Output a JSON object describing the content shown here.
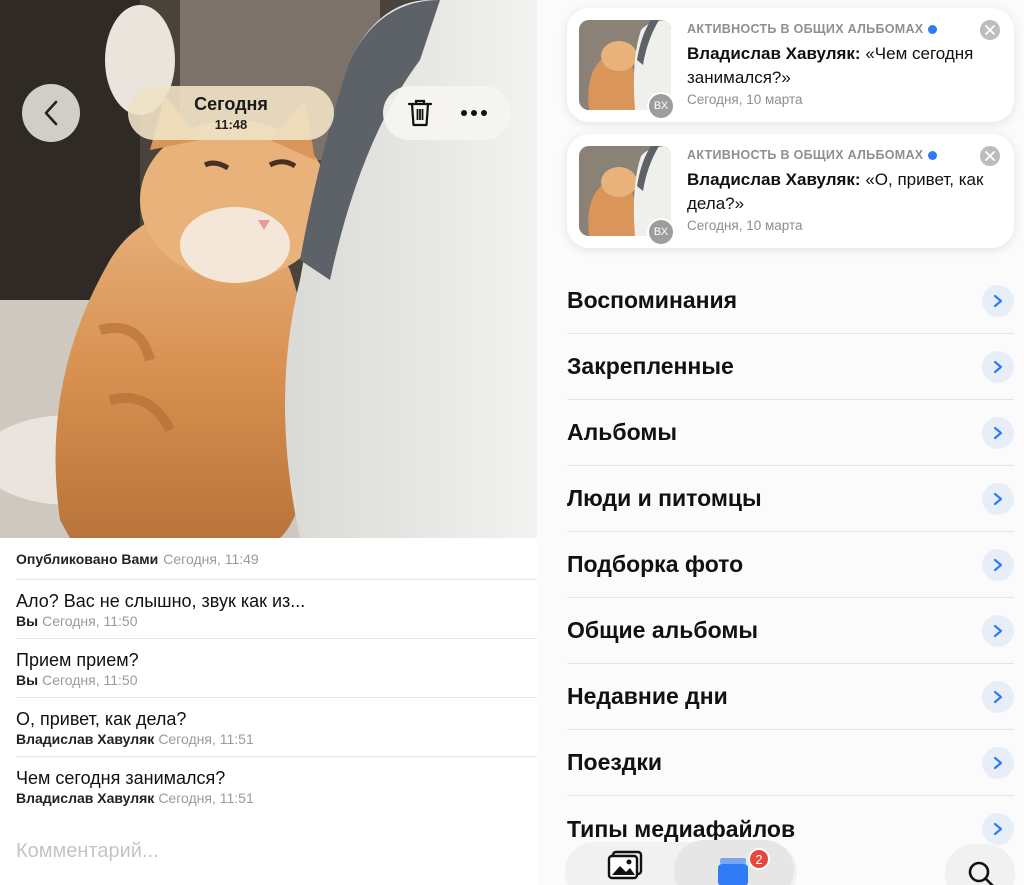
{
  "viewer": {
    "title": "Сегодня",
    "time": "11:48"
  },
  "comments": {
    "posted_by": "Опубликовано Вами",
    "posted_time": "Сегодня, 11:49",
    "items": [
      {
        "text": "Ало? Вас не слышно, звук как из...",
        "author": "Вы",
        "time": "Сегодня, 11:50"
      },
      {
        "text": "Прием прием?",
        "author": "Вы",
        "time": "Сегодня, 11:50"
      },
      {
        "text": "О, привет, как дела?",
        "author": "Владислав Хавуляк",
        "time": "Сегодня, 11:51"
      },
      {
        "text": "Чем сегодня занимался?",
        "author": "Владислав Хавуляк",
        "time": "Сегодня, 11:51"
      }
    ],
    "input_placeholder": "Комментарий..."
  },
  "notifications": [
    {
      "header": "АКТИВНОСТЬ В ОБЩИХ АЛЬБОМАХ",
      "author": "Владислав Хавуляк:",
      "message": "«Чем сегодня занимался?»",
      "date": "Сегодня, 10 марта",
      "initials": "ВХ"
    },
    {
      "header": "АКТИВНОСТЬ В ОБЩИХ АЛЬБОМАХ",
      "author": "Владислав Хавуляк:",
      "message": "«О, привет, как дела?»",
      "date": "Сегодня, 10 марта",
      "initials": "ВХ"
    }
  ],
  "menu": [
    {
      "label": "Воспоминания"
    },
    {
      "label": "Закрепленные"
    },
    {
      "label": "Альбомы"
    },
    {
      "label": "Люди и питомцы"
    },
    {
      "label": "Подборка фото"
    },
    {
      "label": "Общие альбомы"
    },
    {
      "label": "Недавние дни"
    },
    {
      "label": "Поездки"
    },
    {
      "label": "Типы медиафайлов"
    }
  ],
  "tabbar": {
    "collections_badge": "2"
  },
  "icons": {
    "back": "chevron-left-icon",
    "delete": "trash-icon",
    "more": "ellipsis-icon",
    "close": "close-icon",
    "chevron": "chevron-right-icon",
    "library": "photo-library-icon",
    "collections": "collections-icon",
    "search": "search-icon"
  },
  "colors": {
    "accent": "#2f7bf6",
    "badge": "#e8453c"
  }
}
